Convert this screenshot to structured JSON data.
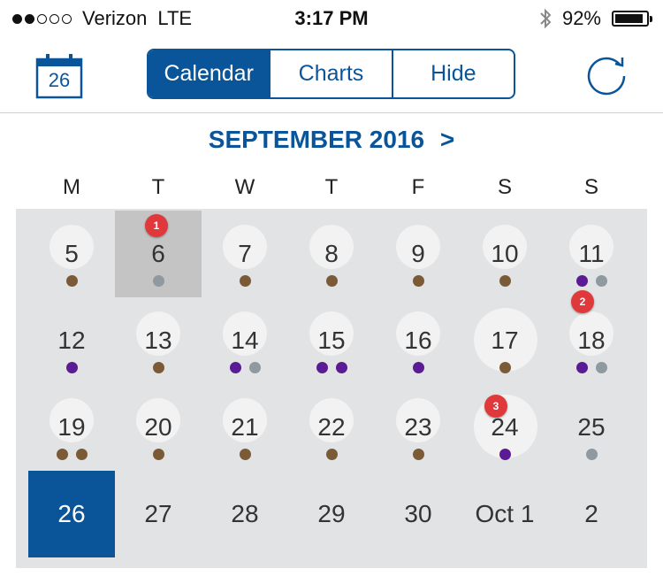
{
  "status_bar": {
    "signal_dots_filled": 2,
    "signal_dots_total": 5,
    "carrier": "Verizon",
    "network": "LTE",
    "time": "3:17 PM",
    "battery_percent": "92%",
    "battery_level": 0.92,
    "bluetooth_icon": "bluetooth-icon"
  },
  "toolbar": {
    "calendar_icon_day": "26",
    "tabs": [
      {
        "label": "Calendar",
        "active": true
      },
      {
        "label": "Charts",
        "active": false
      },
      {
        "label": "Hide",
        "active": false
      }
    ],
    "refresh_icon": "refresh-icon"
  },
  "calendar": {
    "month_title": "SEPTEMBER 2016",
    "next_icon": ">",
    "weekdays": [
      "M",
      "T",
      "W",
      "T",
      "F",
      "S",
      "S"
    ],
    "colors": {
      "brown": "#7b5a36",
      "purple": "#5b1b94",
      "gray": "#8e9aa0",
      "accent": "#0a5599",
      "badge": "#e0393b",
      "grid_bg": "#e2e3e5"
    },
    "weeks": [
      [
        {
          "label": "5",
          "circle": "normal",
          "dots": [
            "brown"
          ]
        },
        {
          "label": "6",
          "selected": true,
          "dots": [
            "gray"
          ],
          "badge": "1"
        },
        {
          "label": "7",
          "circle": "normal",
          "dots": [
            "brown"
          ]
        },
        {
          "label": "8",
          "circle": "normal",
          "dots": [
            "brown"
          ]
        },
        {
          "label": "9",
          "circle": "normal",
          "dots": [
            "brown"
          ]
        },
        {
          "label": "10",
          "circle": "normal",
          "dots": [
            "brown"
          ]
        },
        {
          "label": "11",
          "circle": "normal",
          "dots": [
            "purple",
            "gray"
          ],
          "badge": "2"
        }
      ],
      [
        {
          "label": "12",
          "dots": [
            "purple"
          ]
        },
        {
          "label": "13",
          "circle": "normal",
          "dots": [
            "brown"
          ]
        },
        {
          "label": "14",
          "circle": "normal",
          "dots": [
            "purple",
            "gray"
          ]
        },
        {
          "label": "15",
          "circle": "normal",
          "dots": [
            "purple",
            "purple"
          ]
        },
        {
          "label": "16",
          "circle": "normal",
          "dots": [
            "purple"
          ]
        },
        {
          "label": "17",
          "circle": "big",
          "dots": [
            "brown"
          ]
        },
        {
          "label": "18",
          "circle": "normal",
          "dots": [
            "purple",
            "gray"
          ]
        }
      ],
      [
        {
          "label": "19",
          "circle": "normal",
          "dots": [
            "brown",
            "brown"
          ]
        },
        {
          "label": "20",
          "circle": "normal",
          "dots": [
            "brown"
          ]
        },
        {
          "label": "21",
          "circle": "normal",
          "dots": [
            "brown"
          ]
        },
        {
          "label": "22",
          "circle": "normal",
          "dots": [
            "brown"
          ]
        },
        {
          "label": "23",
          "circle": "normal",
          "dots": [
            "brown"
          ]
        },
        {
          "label": "24",
          "circle": "big",
          "dots": [
            "purple"
          ],
          "badge": "3"
        },
        {
          "label": "25",
          "dots": [
            "gray"
          ]
        }
      ],
      [
        {
          "label": "26",
          "today": true,
          "dots": []
        },
        {
          "label": "27",
          "dots": []
        },
        {
          "label": "28",
          "dots": []
        },
        {
          "label": "29",
          "dots": []
        },
        {
          "label": "30",
          "dots": []
        },
        {
          "label": "Oct 1",
          "dots": []
        },
        {
          "label": "2",
          "dots": []
        }
      ]
    ]
  }
}
